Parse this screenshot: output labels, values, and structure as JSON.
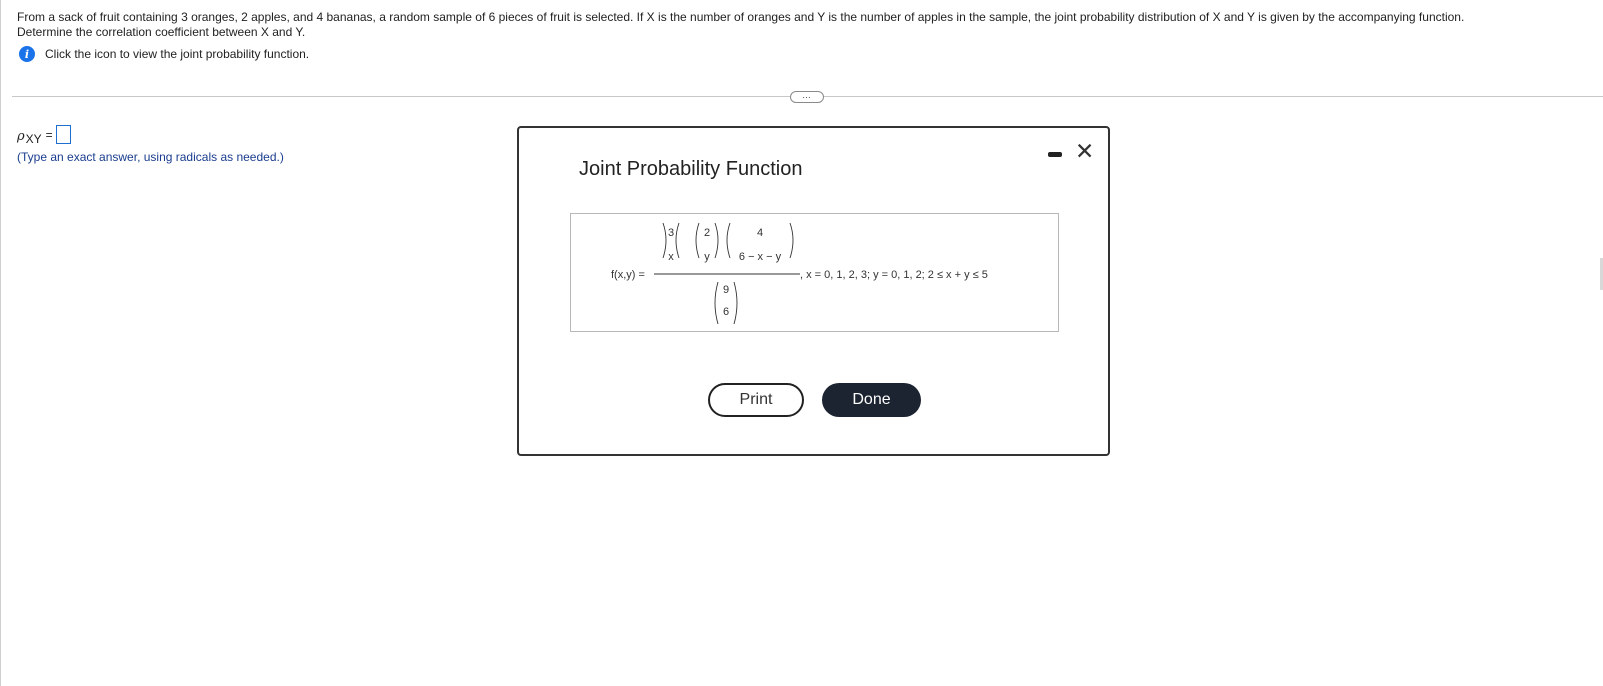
{
  "problem": {
    "text_line1": "From a sack of fruit containing 3 oranges, 2 apples, and 4 bananas, a random sample of 6 pieces of fruit is selected. If X is the number of oranges and Y is the number of apples in the sample, the joint probability distribution of X and Y is given by the accompanying function.",
    "text_line2": "Determine the correlation coefficient between X and Y.",
    "hint": "Click the icon to view the joint probability function.",
    "info_icon": "i"
  },
  "expand_label": "…",
  "answer": {
    "symbol": "ρ",
    "subscript": "XY",
    "equals": "=",
    "value": "",
    "instruction": "(Type an exact answer, using radicals as needed.)"
  },
  "modal": {
    "title": "Joint Probability Function",
    "minimize_label": "minimize",
    "close_label": "✕",
    "formula": {
      "lhs": "f(x,y) =",
      "binom1_top": "3",
      "binom1_bottom": "x",
      "binom2_top": "2",
      "binom2_bottom": "y",
      "binom3_top": "4",
      "binom3_bottom": "6 − x − y",
      "den_top": "9",
      "den_bottom": "6",
      "domain": ", x = 0, 1, 2, 3; y = 0, 1, 2; 2 ≤ x + y ≤ 5"
    },
    "print_label": "Print",
    "done_label": "Done"
  }
}
